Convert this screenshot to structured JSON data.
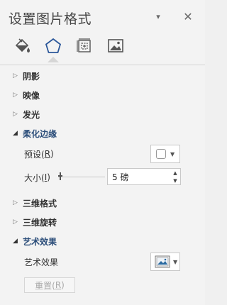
{
  "pane": {
    "title": "设置图片格式",
    "dropdown_glyph": "▾",
    "close_glyph": "✕"
  },
  "tabs": [
    {
      "name": "fill-line",
      "icon": "paint-bucket-icon",
      "active": false
    },
    {
      "name": "effects",
      "icon": "pentagon-icon",
      "active": true
    },
    {
      "name": "size-properties",
      "icon": "size-properties-icon",
      "active": false
    },
    {
      "name": "picture",
      "icon": "picture-icon",
      "active": false
    }
  ],
  "sections": {
    "shadow": {
      "label": "阴影",
      "arrow": "▷"
    },
    "reflection": {
      "label": "映像",
      "arrow": "▷"
    },
    "glow": {
      "label": "发光",
      "arrow": "▷"
    },
    "soft_edges": {
      "label": "柔化边缘",
      "arrow": "◢"
    },
    "three_d_format": {
      "label": "三维格式",
      "arrow": "▷"
    },
    "three_d_rotation": {
      "label": "三维旋转",
      "arrow": "▷"
    },
    "artistic": {
      "label": "艺术效果",
      "arrow": "◢"
    }
  },
  "soft_edges": {
    "preset_label": "预设(",
    "preset_key": "R",
    "preset_suffix": ")",
    "size_label": "大小(",
    "size_key": "I",
    "size_suffix": ")",
    "size_value": "5 磅",
    "size_fraction": 0.05
  },
  "artistic": {
    "label": "艺术效果",
    "reset_label": "重置(",
    "reset_key": "R",
    "reset_suffix": ")"
  },
  "colors": {
    "accent": "#2c4e7a",
    "active_tab_icon": "#2b579a",
    "background": "#f3f3f3"
  }
}
